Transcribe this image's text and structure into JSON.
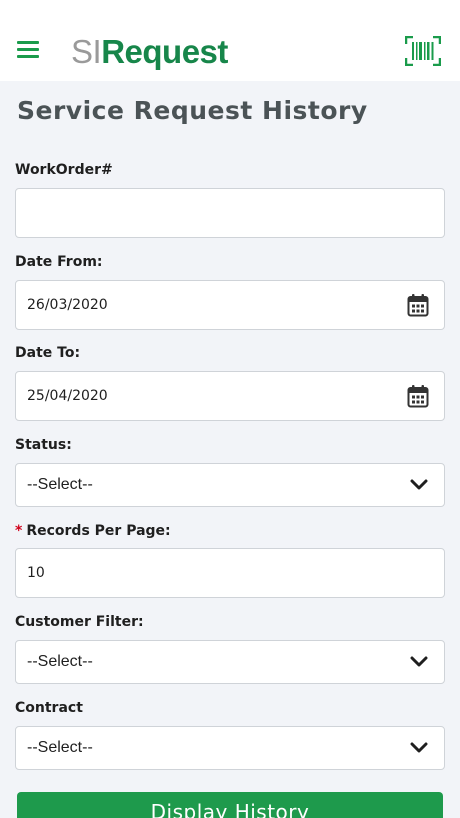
{
  "header": {
    "logo_prefix": "SI",
    "logo_main": "Request",
    "menu_icon": "hamburger-menu-icon",
    "barcode_icon": "barcode-scan-icon",
    "accent_color": "#1a9b4b"
  },
  "page": {
    "title": "Service Request History"
  },
  "form": {
    "workorder_label": "WorkOrder#",
    "workorder_value": "",
    "date_from_label": "Date From:",
    "date_from_value": "26/03/2020",
    "date_to_label": "Date To:",
    "date_to_value": "25/04/2020",
    "status_label": "Status:",
    "status_value": "--Select--",
    "required_marker": "*",
    "records_label": "Records Per Page:",
    "records_value": "10",
    "customer_label": "Customer Filter:",
    "customer_value": "--Select--",
    "contract_label": "Contract",
    "contract_value": "--Select--",
    "submit_label": "Display History"
  }
}
